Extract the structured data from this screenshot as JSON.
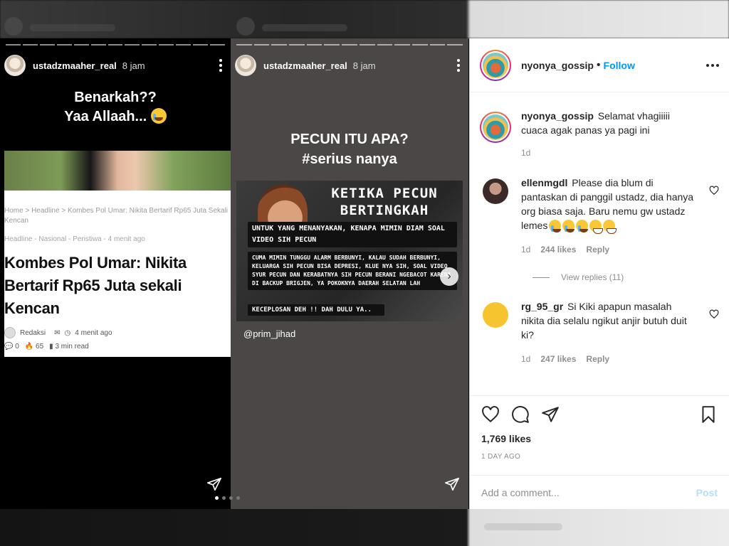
{
  "story1": {
    "username": "ustadzmaaher_real",
    "time": "8 jam",
    "headline_line1": "Benarkah??",
    "headline_line2": "Yaa Allaah...",
    "article": {
      "breadcrumb": "Home  >  Headline  >  Kombes Pol Umar: Nikita Bertarif Rp65 Juta Sekali Kencan",
      "categories": "Headline - Nasional - Peristiwa - 4 menit ago",
      "title": "Kombes Pol Umar: Nikita Bertarif Rp65 Juta sekali Kencan",
      "author": "Redaksi",
      "posted": "4 menit ago",
      "comments": "0",
      "views": "65",
      "read_time": "3 min read"
    }
  },
  "story2": {
    "username": "ustadzmaaher_real",
    "time": "8 jam",
    "headline_line1": "PECUN ITU APA?",
    "headline_line2": "#serius nanya",
    "image_title_1": "KETIKA PECUN",
    "image_title_2": "BERTINGKAH",
    "box1": "UNTUK YANG MENANYAKAN, KENAPA MIMIN DIAM SOAL VIDEO SIH PECUN",
    "box2": "CUMA MIMIN TUNGGU ALARM BERBUNYI, KALAU SUDAH BERBUNYI, KELUARGA SIH PECUN BISA DEPRESI, KLUE NYA SIH, SOAL VIDEO SYUR PECUN DAN KERABATNYA SIH PECUN BERANI NGEBACOT KARENA DI BACKUP BRIGJEN, YA POKOKNYA DAERAH SELATAN LAH",
    "box3": "KECEPLOSAN DEH !! DAH DULU YA..",
    "mention": "@prim_jihad"
  },
  "post": {
    "username": "nyonya_gossip",
    "follow_label": "Follow",
    "caption": {
      "username": "nyonya_gossip",
      "text": "Selamat vhagiiiii cuaca agak panas ya pagi ini",
      "age": "1d"
    },
    "comments": [
      {
        "username": "ellenmgdl",
        "text": "Please dia blum di pantaskan di panggil ustadz, dia hanya org biasa saja. Baru nemu gw ustadz lemes",
        "age": "1d",
        "likes": "244 likes",
        "reply": "Reply",
        "view_replies": "View replies (11)"
      },
      {
        "username": "rg_95_gr",
        "text": "Si Kiki apapun masalah nikita dia selalu ngikut anjir butuh duit ki?",
        "age": "1d",
        "likes": "247 likes",
        "reply": "Reply"
      }
    ],
    "likes": "1,769 likes",
    "date": "1 DAY AGO",
    "add_comment_placeholder": "Add a comment...",
    "post_button": "Post"
  },
  "colors": {
    "follow_blue": "#0095f6",
    "post_disabled": "#b2dffc",
    "story2_bg": "#4a4746"
  }
}
